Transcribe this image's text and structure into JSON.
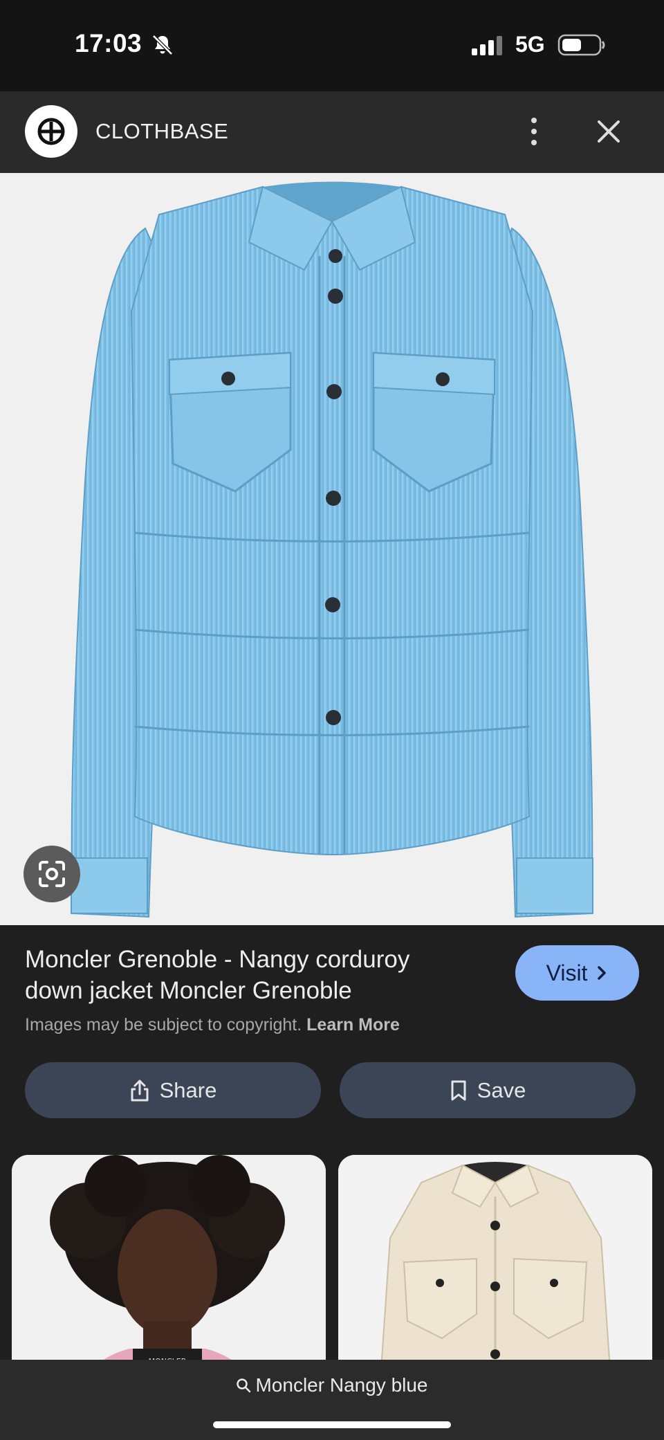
{
  "status_bar": {
    "time": "17:03",
    "network": "5G"
  },
  "site": {
    "name": "CLOTHBASE"
  },
  "product": {
    "title": "Moncler Grenoble - Nangy corduroy down jacket Moncler Grenoble",
    "visit_label": "Visit",
    "copyright_text": "Images may be subject to copyright.",
    "learn_more": "Learn More"
  },
  "actions": {
    "share_label": "Share",
    "save_label": "Save"
  },
  "search": {
    "query": "Moncler Nangy blue"
  },
  "thumbnails": [
    {
      "label": "MONCLER"
    },
    {
      "label": ""
    }
  ],
  "colors": {
    "accent": "#8ab4f8",
    "button_bg": "#3c4556",
    "jacket_blue": "#7fc0e6",
    "jacket_cream": "#ece2cf"
  }
}
